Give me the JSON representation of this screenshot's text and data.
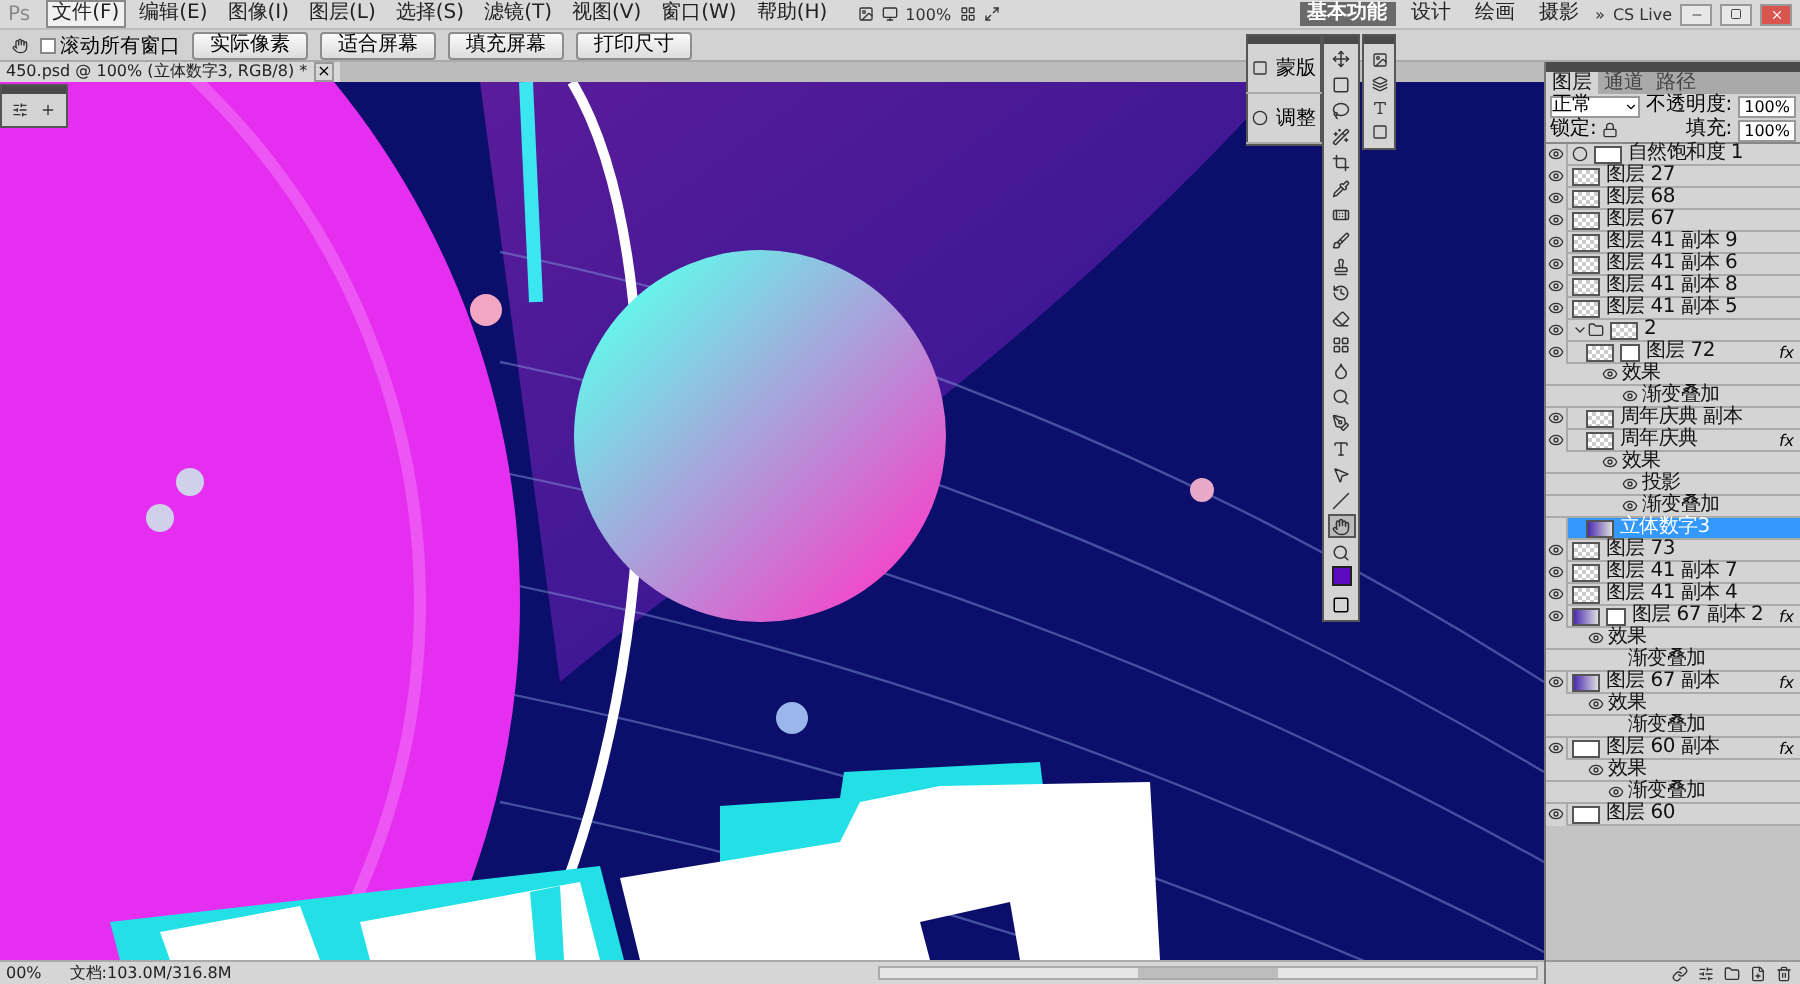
{
  "menu_bar": {
    "logo": "Ps",
    "items": [
      {
        "label": "文件(F)",
        "selected": true
      },
      {
        "label": "编辑(E)",
        "selected": false
      },
      {
        "label": "图像(I)",
        "selected": false
      },
      {
        "label": "图层(L)",
        "selected": false
      },
      {
        "label": "选择(S)",
        "selected": false
      },
      {
        "label": "滤镜(T)",
        "selected": false
      },
      {
        "label": "视图(V)",
        "selected": false
      },
      {
        "label": "窗口(W)",
        "selected": false
      },
      {
        "label": "帮助(H)",
        "selected": false
      }
    ],
    "zoom": "100%",
    "workspaces": [
      {
        "label": "基本功能",
        "selected": true
      },
      {
        "label": "设计",
        "selected": false
      },
      {
        "label": "绘画",
        "selected": false
      },
      {
        "label": "摄影",
        "selected": false
      }
    ],
    "more": "»",
    "cs_live": "CS Live"
  },
  "options_bar": {
    "checkbox": {
      "label": "滚动所有窗口",
      "checked": false
    },
    "buttons": [
      "实际像素",
      "适合屏幕",
      "填充屏幕",
      "打印尺寸"
    ]
  },
  "document_tab": {
    "title": "450.psd @ 100% (立体数字3, RGB/8) *",
    "close": "×"
  },
  "floating_panel": {
    "items": [
      "蒙版",
      "调整"
    ]
  },
  "layers_panel": {
    "tabs": [
      {
        "label": "图层",
        "selected": true
      },
      {
        "label": "通道",
        "selected": false
      },
      {
        "label": "路径",
        "selected": false
      }
    ],
    "blend_mode": "正常",
    "opacity_label": "不透明度:",
    "opacity": "100%",
    "lock_label": "锁定:",
    "fill_label": "填充:",
    "fill": "100%",
    "layers": [
      {
        "kind": "adjustment",
        "name": "自然饱和度 1",
        "visible": true,
        "selected": false
      },
      {
        "kind": "layer",
        "name": "图层 27",
        "visible": true,
        "selected": false
      },
      {
        "kind": "layer",
        "name": "图层 68",
        "visible": true,
        "selected": false
      },
      {
        "kind": "layer",
        "name": "图层 67",
        "visible": true,
        "selected": false
      },
      {
        "kind": "layer",
        "name": "图层 41 副本 9",
        "visible": true,
        "selected": false
      },
      {
        "kind": "layer",
        "name": "图层 41 副本 6",
        "visible": true,
        "selected": false
      },
      {
        "kind": "layer",
        "name": "图层 41 副本 8",
        "visible": true,
        "selected": false
      },
      {
        "kind": "layer",
        "name": "图层 41 副本 5",
        "visible": true,
        "selected": false
      },
      {
        "kind": "group",
        "name": "2",
        "visible": true,
        "selected": false,
        "expanded": true,
        "children": [
          {
            "kind": "masked",
            "name": "图层 72",
            "visible": true,
            "selected": false,
            "fx": "fx",
            "effects_label": "效果",
            "effects": [
              {
                "name": "渐变叠加",
                "visible": true
              }
            ]
          },
          {
            "kind": "layer",
            "name": "周年庆典 副本",
            "visible": true,
            "selected": false
          },
          {
            "kind": "layer",
            "name": "周年庆典",
            "visible": true,
            "selected": false,
            "fx": "fx",
            "effects_label": "效果",
            "effects": [
              {
                "name": "投影",
                "visible": true
              },
              {
                "name": "渐变叠加",
                "visible": true
              }
            ]
          },
          {
            "kind": "art",
            "name": "立体数字3",
            "visible": false,
            "selected": true
          }
        ]
      },
      {
        "kind": "layer",
        "name": "图层 73",
        "visible": true,
        "selected": false
      },
      {
        "kind": "layer",
        "name": "图层 41 副本 7",
        "visible": true,
        "selected": false
      },
      {
        "kind": "layer",
        "name": "图层 41 副本 4",
        "visible": true,
        "selected": false
      },
      {
        "kind": "masked_art",
        "name": "图层 67 副本 2",
        "visible": true,
        "selected": false,
        "fx": "fx",
        "effects_label": "效果",
        "effects": [
          {
            "name": "渐变叠加",
            "visible": false
          }
        ]
      },
      {
        "kind": "art",
        "name": "图层 67 副本",
        "visible": true,
        "selected": false,
        "fx": "fx",
        "effects_label": "效果",
        "effects": [
          {
            "name": "渐变叠加",
            "visible": false
          }
        ]
      },
      {
        "kind": "white",
        "name": "图层 60 副本",
        "visible": true,
        "selected": false,
        "fx": "fx",
        "effects_label": "效果",
        "effects": [
          {
            "name": "渐变叠加",
            "visible": true
          }
        ]
      },
      {
        "kind": "white",
        "name": "图层 60",
        "visible": true,
        "selected": false
      }
    ]
  },
  "status_bar": {
    "zoom": "00%",
    "doc": "文档:103.0M/316.8M"
  }
}
